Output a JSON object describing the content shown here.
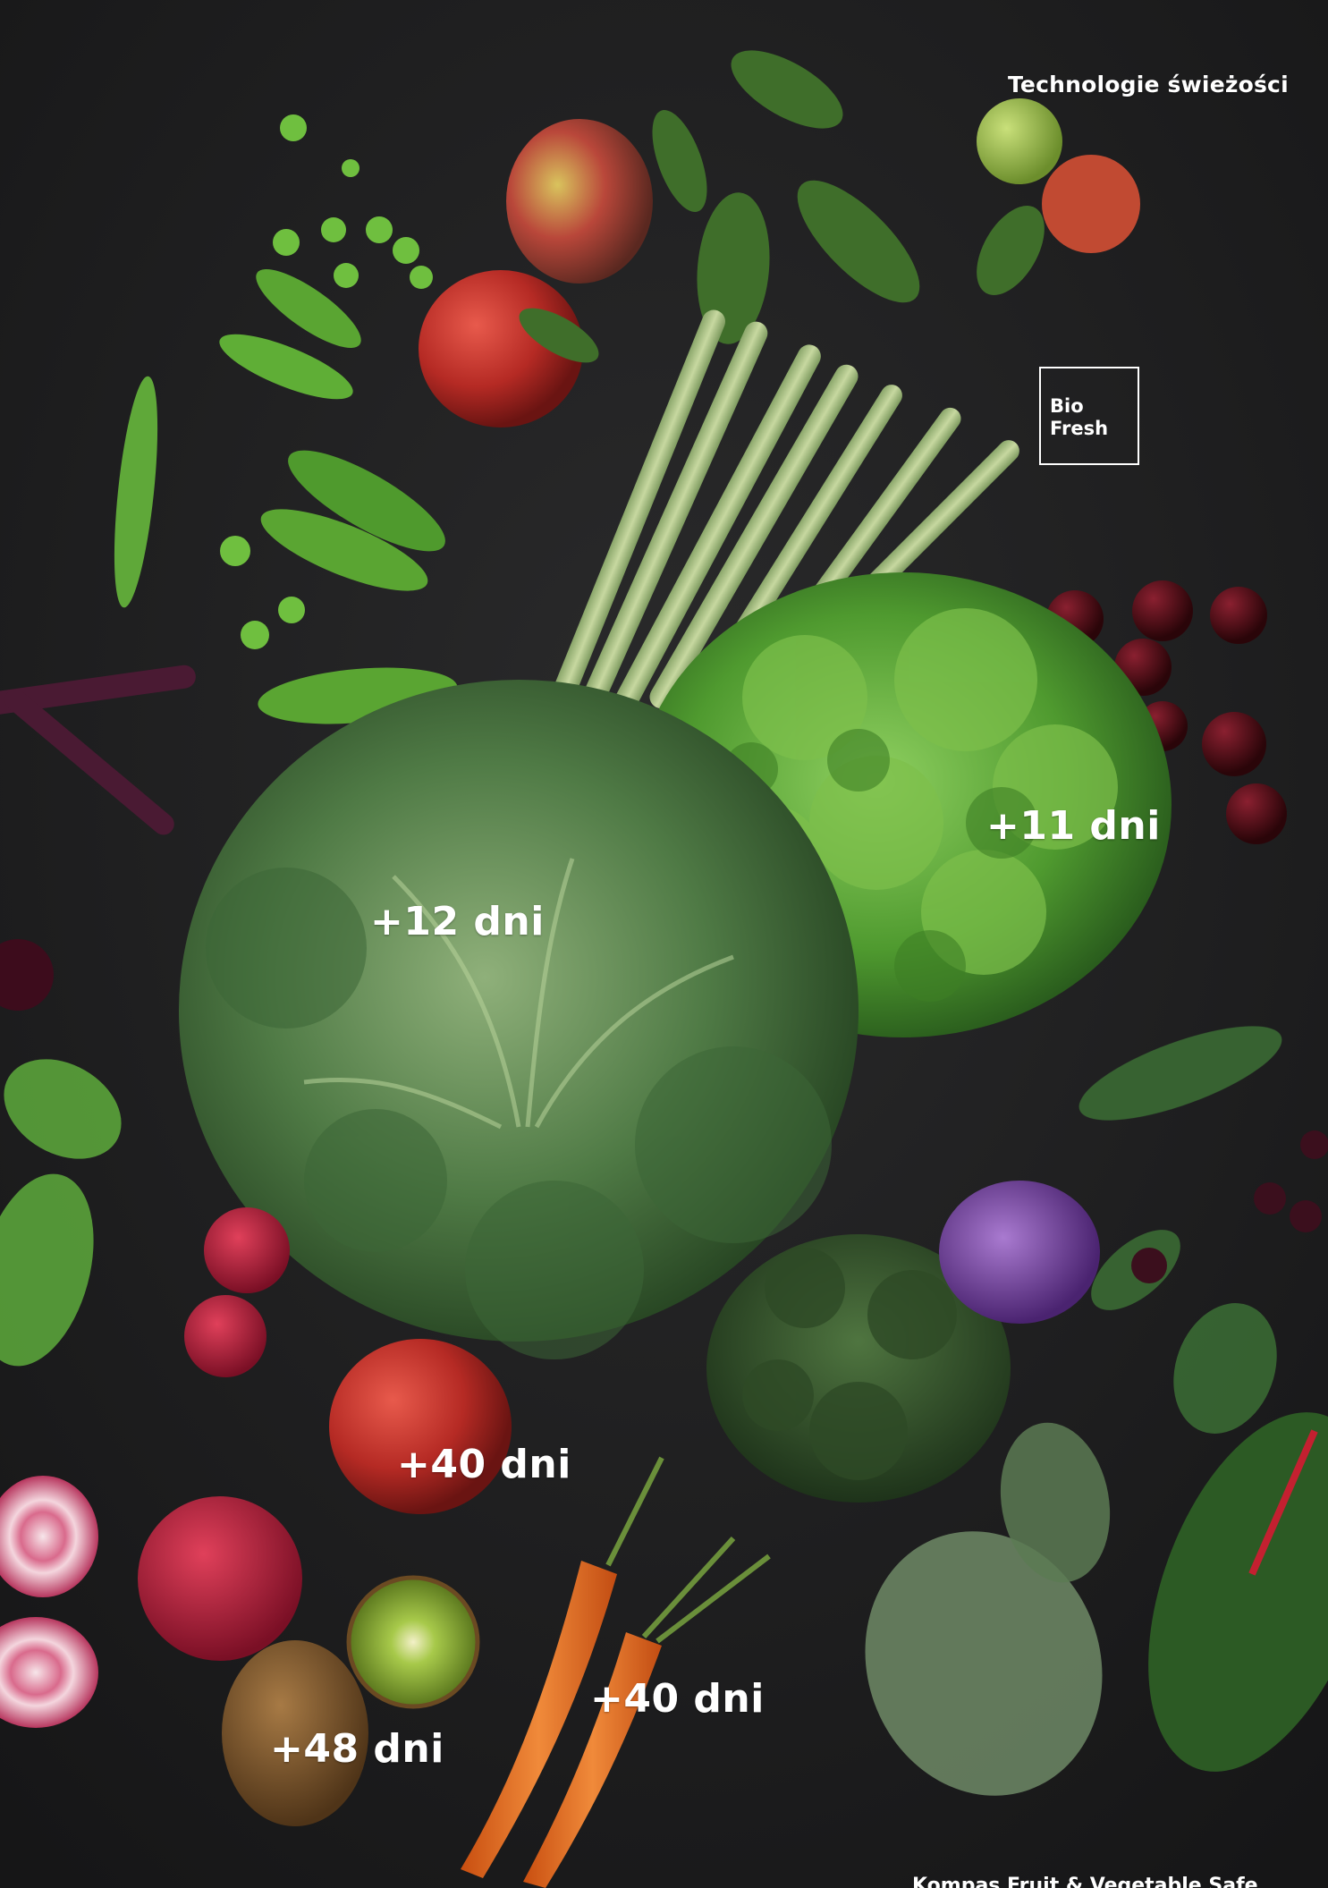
{
  "header": {
    "section_title": "Technologie świeżości"
  },
  "badge": {
    "line1": "Bio",
    "line2": "Fresh"
  },
  "labels": {
    "cabbage": "+12 dni",
    "lettuce": "+11 dni",
    "apple": "+40 dni",
    "carrot": "+40 dni",
    "kiwi": "+48 dni"
  },
  "footer": {
    "text": "Kompas Fruit & Vegetable Safe"
  },
  "colors": {
    "background": "#1e1e1f",
    "text": "#ffffff"
  }
}
